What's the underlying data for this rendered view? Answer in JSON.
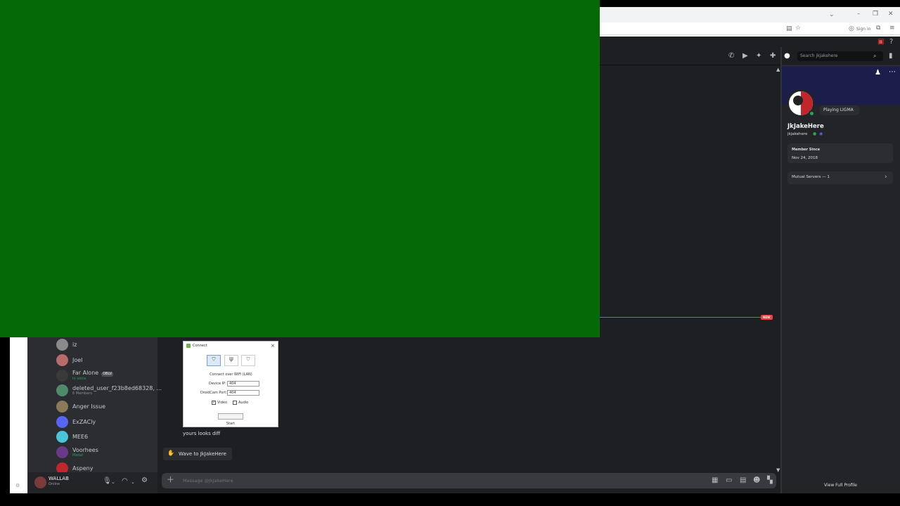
{
  "browser": {
    "signin_label": "Sign in"
  },
  "header": {
    "search_placeholder": "Search jkjakehere"
  },
  "dm_list": [
    {
      "name": "iz",
      "sub": ""
    },
    {
      "name": "Joel",
      "sub": ""
    },
    {
      "name": "Far Alone",
      "sub": "In voice",
      "badge": "OBLV"
    },
    {
      "name": "deleted_user_f23b8ed68328, ...",
      "sub": "6 Members"
    },
    {
      "name": "Anger Issue",
      "sub": ""
    },
    {
      "name": "ExZACly",
      "sub": ""
    },
    {
      "name": "MEE6",
      "sub": ""
    },
    {
      "name": "Voorhees",
      "sub": "Medal"
    },
    {
      "name": "Aspeny",
      "sub": ""
    }
  ],
  "user_panel": {
    "name": "WALLAB",
    "status": "Online"
  },
  "dialog": {
    "title": "Connect",
    "subtitle": "Connect over WiFi (LAN)",
    "device_ip_label": "Device IP:",
    "device_ip_value": "404",
    "port_label": "DroidCam Port:",
    "port_value": "404",
    "video_label": "Video",
    "audio_label": "Audio",
    "start_label": "Start"
  },
  "chat": {
    "message": "yours looks diff",
    "wave_label": "Wave to JkJakeHere",
    "input_placeholder": "Message @JkJakeHere",
    "new_badge": "NEW"
  },
  "profile": {
    "activity": "Playing LIGMA",
    "display_name": "JkJakeHere",
    "username": "jkjakehere",
    "member_since_label": "Member Since",
    "member_since_value": "Nov 24, 2018",
    "mutual_servers": "Mutual Servers — 1",
    "view_full_profile": "View Full Profile"
  },
  "colors": {
    "green_overlay": "#056a05",
    "discord_bg": "#1e1f22",
    "accent_red": "#f23f43",
    "online_green": "#23a55a"
  }
}
